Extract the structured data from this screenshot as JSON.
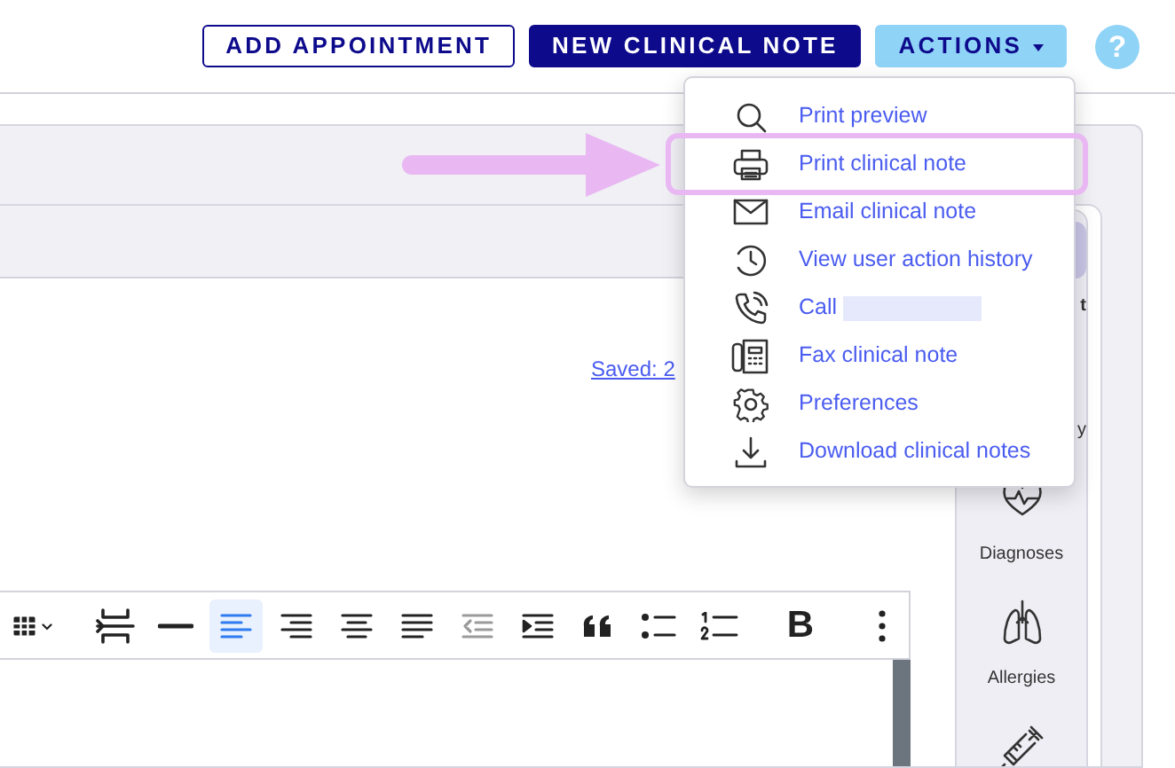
{
  "header": {
    "buttons": [
      {
        "kind": "outline",
        "label": "ADD APPOINTMENT"
      },
      {
        "kind": "primary",
        "label": "NEW CLINICAL NOTE"
      },
      {
        "kind": "dropdown",
        "label": "ACTIONS",
        "expanded": true
      },
      {
        "kind": "help",
        "label": "?"
      }
    ]
  },
  "actions_menu": {
    "items": [
      {
        "kind": "search",
        "label": "Print preview",
        "highlighted": false
      },
      {
        "kind": "printer",
        "label": "Print clinical note",
        "highlighted": true
      },
      {
        "kind": "mail",
        "label": "Email clinical note",
        "highlighted": false
      },
      {
        "kind": "history",
        "label": "View user action history",
        "highlighted": false
      },
      {
        "kind": "phone",
        "label": "Call",
        "redacted": true,
        "highlighted": false
      },
      {
        "kind": "fax",
        "label": "Fax clinical note",
        "highlighted": false
      },
      {
        "kind": "gear",
        "label": "Preferences",
        "highlighted": false
      },
      {
        "kind": "download",
        "label": "Download clinical notes",
        "highlighted": false
      }
    ]
  },
  "note": {
    "saved_link": "Saved: 2"
  },
  "toolbar": {
    "buttons": [
      {
        "kind": "table",
        "selected": false,
        "disabled": false
      },
      {
        "kind": "separator"
      },
      {
        "kind": "pagebreak",
        "selected": false,
        "disabled": false
      },
      {
        "kind": "hr",
        "selected": false,
        "disabled": false
      },
      {
        "kind": "align-left",
        "selected": true,
        "disabled": false
      },
      {
        "kind": "align-right",
        "selected": false,
        "disabled": false
      },
      {
        "kind": "align-center",
        "selected": false,
        "disabled": false
      },
      {
        "kind": "justify",
        "selected": false,
        "disabled": false
      },
      {
        "kind": "outdent",
        "selected": false,
        "disabled": true
      },
      {
        "kind": "indent",
        "selected": false,
        "disabled": false
      },
      {
        "kind": "quote",
        "selected": false,
        "disabled": false
      },
      {
        "kind": "bullets",
        "selected": false,
        "disabled": false
      },
      {
        "kind": "numbered",
        "selected": false,
        "disabled": false
      },
      {
        "kind": "separator"
      },
      {
        "kind": "bold",
        "label": "B",
        "selected": false,
        "disabled": false
      },
      {
        "kind": "separator"
      },
      {
        "kind": "more",
        "selected": false,
        "disabled": false
      }
    ]
  },
  "sidebar": {
    "items": [
      {
        "kind": "covered",
        "label": "t",
        "selected": true
      },
      {
        "kind": "covered",
        "label": "y",
        "selected": false
      },
      {
        "kind": "heart",
        "label": "Diagnoses",
        "selected": false
      },
      {
        "kind": "lungs",
        "label": "Allergies",
        "selected": false
      },
      {
        "kind": "syringe",
        "selected": false
      }
    ]
  }
}
